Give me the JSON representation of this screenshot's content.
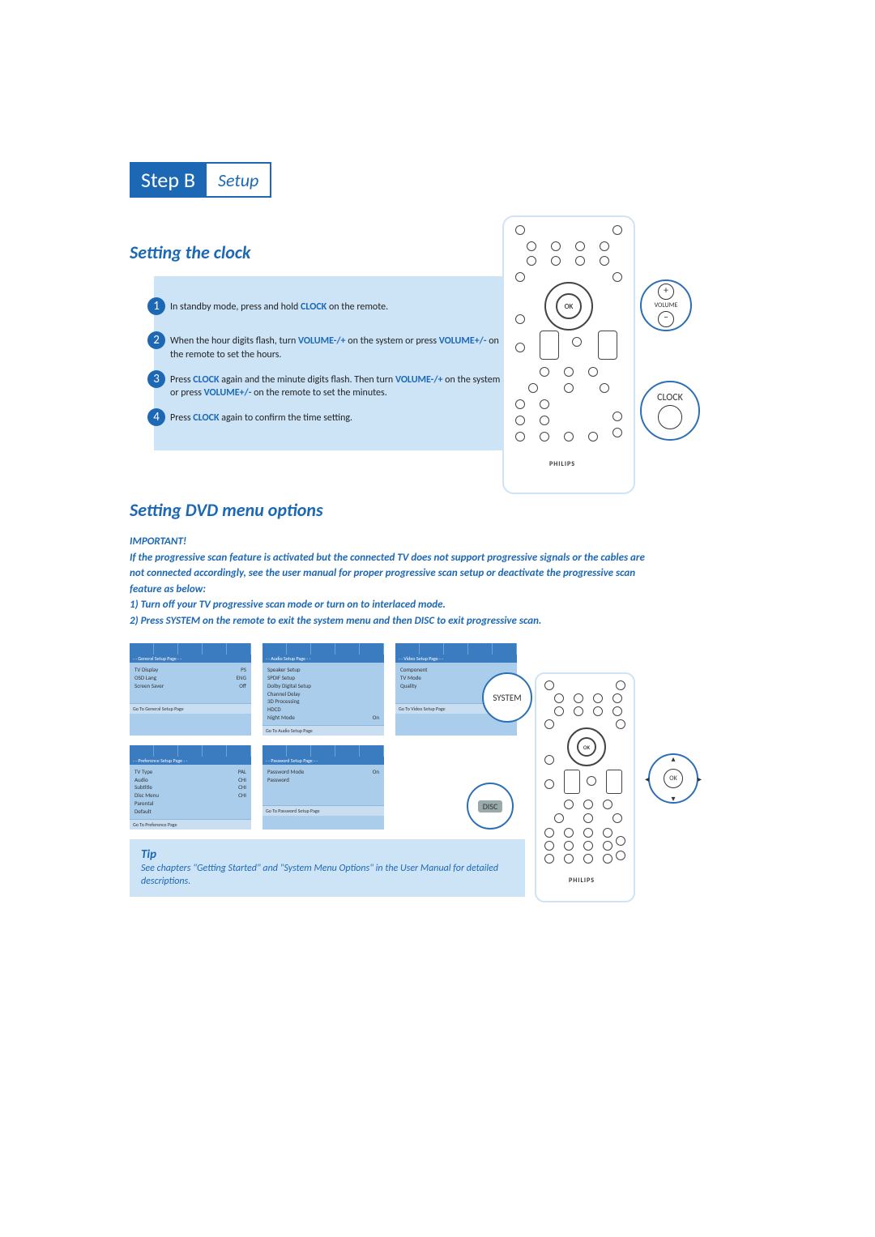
{
  "header": {
    "step_label": "Step B",
    "step_title": "Setup"
  },
  "section1": {
    "title": "Setting the clock",
    "steps": {
      "s1": {
        "num": "1",
        "pre": "In standby mode, press and hold ",
        "kw1": "CLOCK",
        "post": " on the remote."
      },
      "s2": {
        "num": "2",
        "pre": "When the hour digits flash, turn ",
        "kw1": "VOLUME-/+",
        "mid": " on the system or press ",
        "kw2": "VOLUME+/-",
        "post": " on the remote to set the hours."
      },
      "s3": {
        "num": "3",
        "pre": "Press ",
        "kw1": "CLOCK",
        "mid": " again and the minute digits flash. Then turn ",
        "kw2": "VOLUME-/+",
        "mid2": " on the system or press ",
        "kw3": "VOLUME+/-",
        "post": " on the remote to set the minutes."
      },
      "s4": {
        "num": "4",
        "pre": "Press ",
        "kw1": "CLOCK",
        "post": " again to confirm the time setting."
      }
    }
  },
  "remote1": {
    "ok_label": "OK",
    "volume_label": "VOLUME",
    "plus": "+",
    "minus": "–",
    "clock_label": "CLOCK",
    "brand": "PHILIPS"
  },
  "section2": {
    "title": "Setting DVD menu options",
    "important_head": "IMPORTANT!",
    "important_body": "If the progressive scan feature is activated but the connected TV does not support progressive signals or the cables are not connected accordingly, see the user manual for proper progressive scan setup or deactivate the progressive scan feature as below:\n1) Turn off your TV progressive scan mode or turn on to interlaced mode.\n2) Press SYSTEM on the remote to exit the system menu and then DISC to exit progressive scan."
  },
  "menus": {
    "general": {
      "title": "- - General Setup Page - -",
      "rows": [
        [
          "TV Display",
          "PS"
        ],
        [
          "OSD Lang",
          "ENG"
        ],
        [
          "Screen Saver",
          "Off"
        ]
      ],
      "footer": "Go To General Setup Page"
    },
    "audio": {
      "title": "- - Audio Setup Page - -",
      "rows": [
        [
          "Speaker Setup",
          ""
        ],
        [
          "SPDIF Setup",
          ""
        ],
        [
          "Dolby Digital Setup",
          ""
        ],
        [
          "Channel Delay",
          ""
        ],
        [
          "3D Processing",
          ""
        ],
        [
          "HDCD",
          ""
        ],
        [
          "Night Mode",
          "On"
        ]
      ],
      "footer": "Go To Audio Setup Page"
    },
    "video": {
      "title": "- - Video Setup Page - -",
      "rows": [
        [
          "Component",
          ""
        ],
        [
          "TV Mode",
          ""
        ],
        [
          "Quality",
          ""
        ]
      ],
      "footer": "Go To Video Setup Page"
    },
    "preference": {
      "title": "- - Preference Setup Page - -",
      "rows": [
        [
          "TV Type",
          "PAL"
        ],
        [
          "Audio",
          "CHI"
        ],
        [
          "Subtitle",
          "CHI"
        ],
        [
          "Disc Menu",
          "CHI"
        ],
        [
          "Parental",
          ""
        ],
        [
          "Default",
          ""
        ]
      ],
      "footer": "Go To Preference Page"
    },
    "password": {
      "title": "- - Password Setup Page - -",
      "rows": [
        [
          "Password Mode",
          "On"
        ],
        [
          "Password",
          ""
        ]
      ],
      "footer": "Go To Password Setup Page"
    }
  },
  "callouts2": {
    "system": "SYSTEM",
    "disc": "DISC",
    "ok": "OK"
  },
  "remote2": {
    "brand": "PHILIPS"
  },
  "tip": {
    "title": "Tip",
    "body": "See chapters \"Getting Started\" and \"System Menu Options\" in the User Manual for detailed descriptions."
  }
}
